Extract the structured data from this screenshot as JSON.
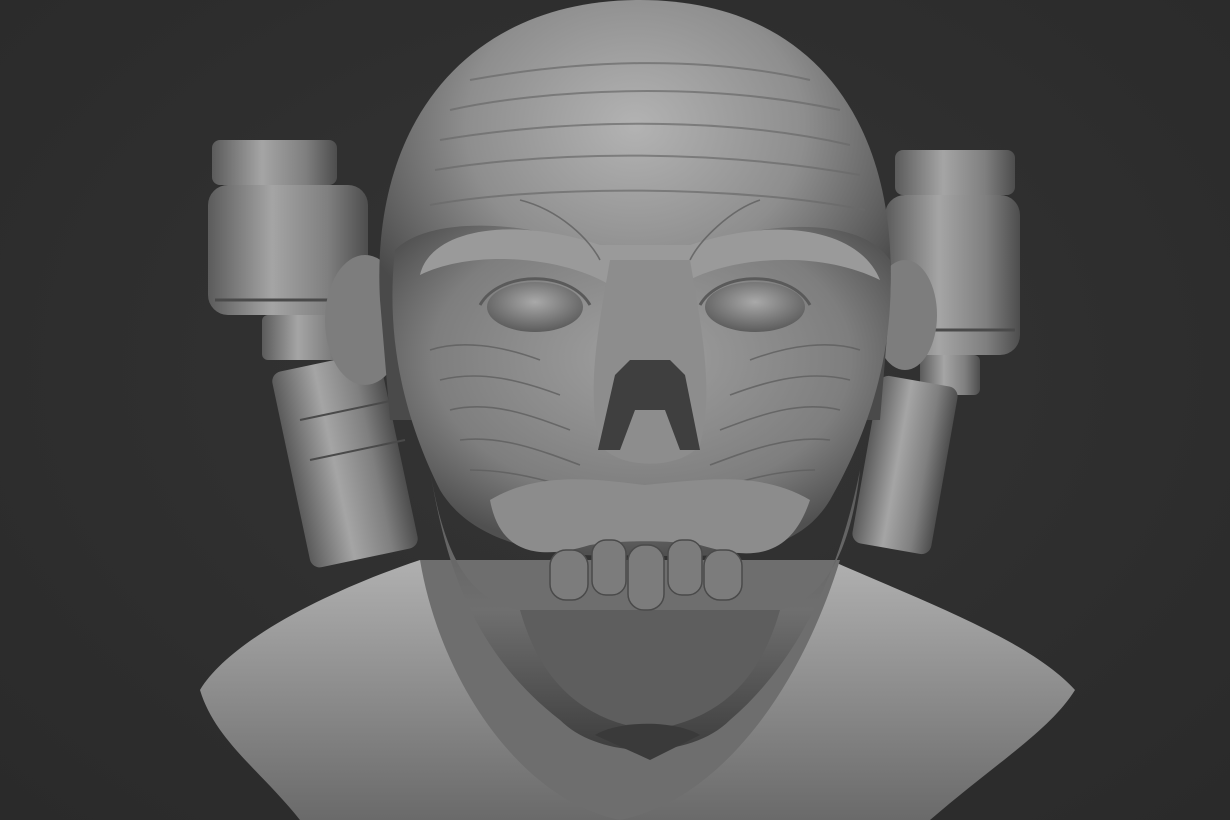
{
  "scene": {
    "background_color": "#2f2f2f",
    "material_color": "#8a8a8a",
    "subject": "sculpted-creature-bust"
  }
}
